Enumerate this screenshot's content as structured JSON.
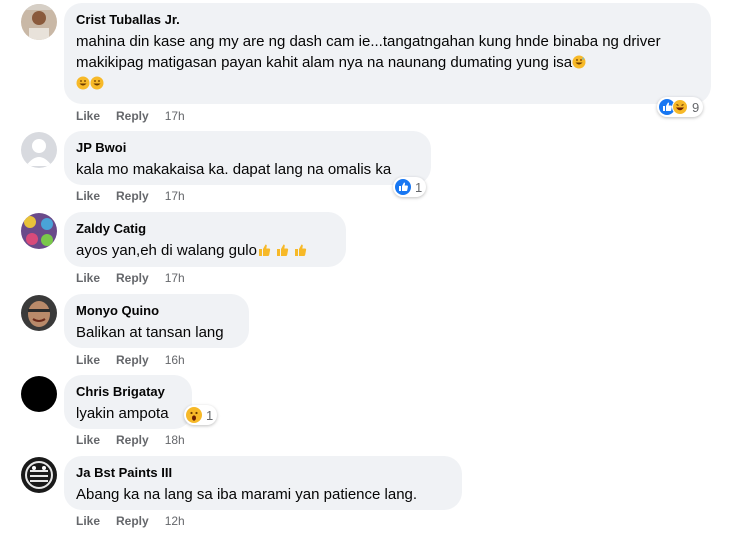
{
  "comments": [
    {
      "author": "Crist Tuballas Jr.",
      "text": "mahina din kase ang my are ng dash cam ie...tangatngahan kung hnde binaba ng driver makikipag matigasan payan kahit alam nya na naunang dumating yung isa",
      "reaction_icons": [
        "like-reaction-icon",
        "haha-reaction-icon"
      ],
      "reaction_count": "9",
      "like_label": "Like",
      "reply_label": "Reply",
      "time": "17h"
    },
    {
      "author": "JP Bwoi",
      "text": "kala mo makakaisa ka. dapat lang na omalis ka",
      "reaction_icons": [
        "like-reaction-icon"
      ],
      "reaction_count": "1",
      "like_label": "Like",
      "reply_label": "Reply",
      "time": "17h"
    },
    {
      "author": "Zaldy Catig",
      "text": "ayos yan,eh di walang gulo",
      "like_label": "Like",
      "reply_label": "Reply",
      "time": "17h"
    },
    {
      "author": "Monyo Quino",
      "text": "Balikan at tansan lang",
      "like_label": "Like",
      "reply_label": "Reply",
      "time": "16h"
    },
    {
      "author": "Chris Brigatay",
      "text": "lyakin ampota",
      "reaction_icons": [
        "wow-reaction-icon"
      ],
      "reaction_count": "1",
      "like_label": "Like",
      "reply_label": "Reply",
      "time": "18h"
    },
    {
      "author": "Ja Bst Paints III",
      "text": "Abang ka na lang sa iba marami yan patience lang.",
      "like_label": "Like",
      "reply_label": "Reply",
      "time": "12h"
    }
  ],
  "colors": {
    "bubble": "#f0f2f5",
    "meta": "#65676b",
    "like_blue": "#1877f2",
    "emoji_yellow": "#f7b928"
  }
}
